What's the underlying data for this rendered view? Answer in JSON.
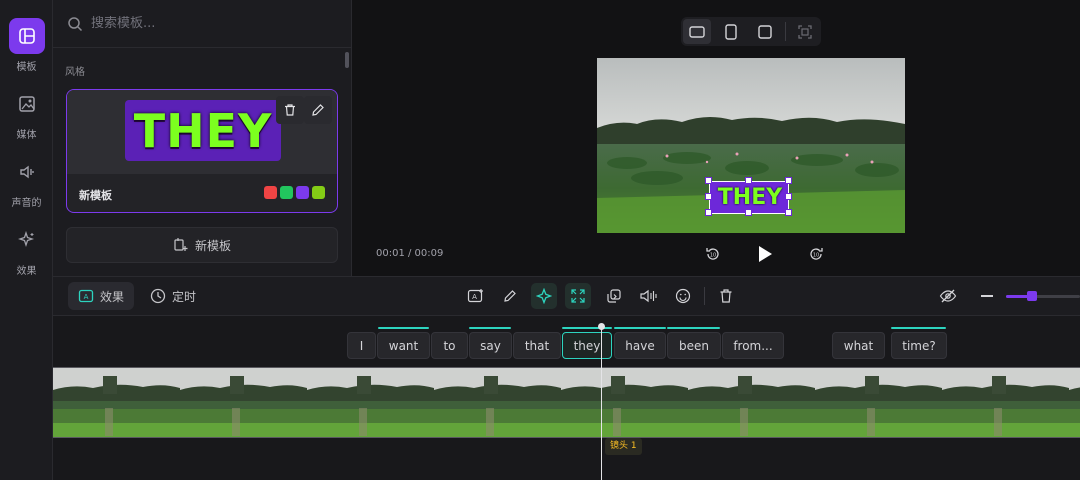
{
  "rail": {
    "items": [
      {
        "label": "模板",
        "icon": "template-icon",
        "active": true
      },
      {
        "label": "媒体",
        "icon": "media-icon",
        "active": false
      },
      {
        "label": "声音的",
        "icon": "audio-icon",
        "active": false
      },
      {
        "label": "效果",
        "icon": "effects-icon",
        "active": false
      }
    ]
  },
  "panel": {
    "search_placeholder": "搜索模板...",
    "section_label": "风格",
    "template": {
      "preview_text": "THEY",
      "name": "新模板",
      "swatches": [
        "#ef4444",
        "#22c55e",
        "#7c3aed",
        "#84cc16"
      ]
    },
    "new_template_label": "新模板"
  },
  "preview": {
    "timecode": "00:01 / 00:09",
    "overlay_text": "THEY"
  },
  "toolbar": {
    "effects_tab": "效果",
    "timer_tab": "定时",
    "zoom_level": 0.35
  },
  "timeline": {
    "words": [
      "I",
      "want",
      "to",
      "say",
      "that",
      "they",
      "have",
      "been",
      "from...",
      "what",
      "time?"
    ],
    "active_word": "they",
    "shot_label": "镜头 1"
  },
  "colors": {
    "accent": "#7c3aed",
    "teal": "#2dd4bf",
    "text_green": "#7cff1f"
  }
}
